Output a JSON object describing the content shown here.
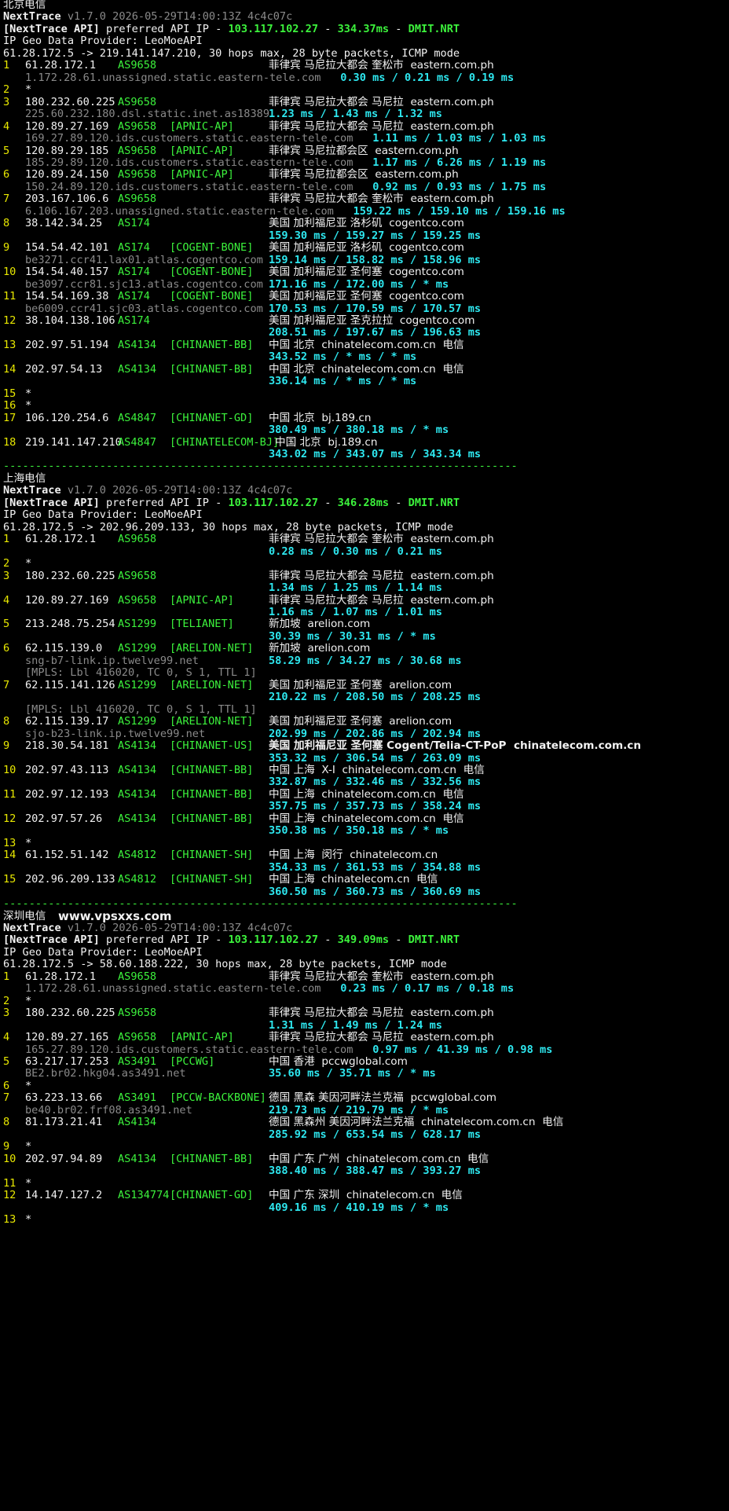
{
  "meta": {
    "tool": "NextTrace",
    "version": "v1.7.0 2026-05-29T14:00:13Z 4c4c07c",
    "api_label": "[NextTrace API]",
    "api_text": "preferred API IP - ",
    "api_ip": "103.117.102.27",
    "api_node": "DMIT.NRT",
    "geo": "IP Geo Data Provider: LeoMoeAPI",
    "separator": "--------------------------------------------------------------------------------"
  },
  "sections": [
    {
      "title": "北京电信",
      "watermark": "",
      "api_latency": "334.37ms",
      "cmd": "61.28.172.5 -> 219.141.147.210, 30 hops max, 28 byte packets, ICMP mode",
      "lines": [
        {
          "t": "hop",
          "hop": "1",
          "ip": "61.28.172.1",
          "as": "AS9658",
          "tag": "",
          "loc": "菲律宾 马尼拉大都会 奎松市",
          "domain": "eastern.com.ph",
          "isp": ""
        },
        {
          "t": "rtt",
          "ptr": "1.172.28.61.unassigned.static.eastern-tele.com",
          "rtt": "0.30 ms / 0.21 ms / 0.19 ms"
        },
        {
          "t": "star",
          "hop": "2"
        },
        {
          "t": "hop",
          "hop": "3",
          "ip": "180.232.60.225",
          "as": "AS9658",
          "tag": "",
          "loc": "菲律宾 马尼拉大都会 马尼拉",
          "domain": "eastern.com.ph",
          "isp": ""
        },
        {
          "t": "rtt",
          "ptr": "225.60.232.180.dsl.static.inet.as18389",
          "rtt": "1.23 ms / 1.43 ms / 1.32 ms"
        },
        {
          "t": "hop",
          "hop": "4",
          "ip": "120.89.27.169",
          "as": "AS9658",
          "tag": "[APNIC-AP]",
          "loc": "菲律宾 马尼拉大都会 马尼拉",
          "domain": "eastern.com.ph",
          "isp": ""
        },
        {
          "t": "rtt",
          "ptr": "169.27.89.120.ids.customers.static.eastern-tele.com",
          "rtt": "1.11 ms / 1.03 ms / 1.03 ms"
        },
        {
          "t": "hop",
          "hop": "5",
          "ip": "120.89.29.185",
          "as": "AS9658",
          "tag": "[APNIC-AP]",
          "loc": "菲律宾 马尼拉都会区",
          "domain": "eastern.com.ph",
          "isp": ""
        },
        {
          "t": "rtt",
          "ptr": "185.29.89.120.ids.customers.static.eastern-tele.com",
          "rtt": "1.17 ms / 6.26 ms / 1.19 ms"
        },
        {
          "t": "hop",
          "hop": "6",
          "ip": "120.89.24.150",
          "as": "AS9658",
          "tag": "[APNIC-AP]",
          "loc": "菲律宾 马尼拉都会区",
          "domain": "eastern.com.ph",
          "isp": ""
        },
        {
          "t": "rtt",
          "ptr": "150.24.89.120.ids.customers.static.eastern-tele.com",
          "rtt": "0.92 ms / 0.93 ms / 1.75 ms"
        },
        {
          "t": "hop",
          "hop": "7",
          "ip": "203.167.106.6",
          "as": "AS9658",
          "tag": "",
          "loc": "菲律宾 马尼拉大都会 奎松市",
          "domain": "eastern.com.ph",
          "isp": ""
        },
        {
          "t": "rtt",
          "ptr": "6.106.167.203.unassigned.static.eastern-tele.com",
          "rtt": "159.22 ms / 159.10 ms / 159.16 ms"
        },
        {
          "t": "hop",
          "hop": "8",
          "ip": "38.142.34.25",
          "as": "AS174",
          "tag": "",
          "loc": "美国 加利福尼亚 洛杉矶",
          "domain": "cogentco.com",
          "isp": ""
        },
        {
          "t": "rtt",
          "ptr": "",
          "rtt": "159.30 ms / 159.27 ms / 159.25 ms"
        },
        {
          "t": "hop",
          "hop": "9",
          "ip": "154.54.42.101",
          "as": "AS174",
          "tag": "[COGENT-BONE]",
          "loc": "美国 加利福尼亚 洛杉矶",
          "domain": "cogentco.com",
          "isp": ""
        },
        {
          "t": "rtt",
          "ptr": "be3271.ccr41.lax01.atlas.cogentco.com",
          "rtt": "159.14 ms / 158.82 ms / 158.96 ms"
        },
        {
          "t": "hop",
          "hop": "10",
          "ip": "154.54.40.157",
          "as": "AS174",
          "tag": "[COGENT-BONE]",
          "loc": "美国 加利福尼亚 圣何塞",
          "domain": "cogentco.com",
          "isp": ""
        },
        {
          "t": "rtt",
          "ptr": "be3097.ccr81.sjc13.atlas.cogentco.com",
          "rtt": "171.16 ms / 172.00 ms / * ms"
        },
        {
          "t": "hop",
          "hop": "11",
          "ip": "154.54.169.38",
          "as": "AS174",
          "tag": "[COGENT-BONE]",
          "loc": "美国 加利福尼亚 圣何塞",
          "domain": "cogentco.com",
          "isp": ""
        },
        {
          "t": "rtt",
          "ptr": "be6009.ccr41.sjc03.atlas.cogentco.com",
          "rtt": "170.53 ms / 170.59 ms / 170.57 ms"
        },
        {
          "t": "hop",
          "hop": "12",
          "ip": "38.104.138.106",
          "as": "AS174",
          "tag": "",
          "loc": "美国 加利福尼亚 圣克拉拉",
          "domain": "cogentco.com",
          "isp": ""
        },
        {
          "t": "rtt",
          "ptr": "",
          "rtt": "208.51 ms / 197.67 ms / 196.63 ms"
        },
        {
          "t": "hop",
          "hop": "13",
          "ip": "202.97.51.194",
          "as": "AS4134",
          "tag": "[CHINANET-BB]",
          "loc": "中国 北京",
          "domain": "chinatelecom.com.cn",
          "isp": "电信"
        },
        {
          "t": "rtt",
          "ptr": "",
          "rtt": "343.52 ms / * ms / * ms"
        },
        {
          "t": "hop",
          "hop": "14",
          "ip": "202.97.54.13",
          "as": "AS4134",
          "tag": "[CHINANET-BB]",
          "loc": "中国 北京",
          "domain": "chinatelecom.com.cn",
          "isp": "电信"
        },
        {
          "t": "rtt",
          "ptr": "",
          "rtt": "336.14 ms / * ms / * ms"
        },
        {
          "t": "star",
          "hop": "15"
        },
        {
          "t": "star",
          "hop": "16"
        },
        {
          "t": "hop",
          "hop": "17",
          "ip": "106.120.254.6",
          "as": "AS4847",
          "tag": "[CHINANET-GD]",
          "loc": "中国 北京",
          "domain": "bj.189.cn",
          "isp": ""
        },
        {
          "t": "rtt",
          "ptr": "",
          "rtt": "380.49 ms / 380.18 ms / * ms"
        },
        {
          "t": "hop",
          "hop": "18",
          "ip": "219.141.147.210",
          "as": "AS4847",
          "tag": "[CHINATELECOM-BJ]",
          "loc": "中国 北京",
          "domain": "bj.189.cn",
          "isp": "",
          "wide": true
        },
        {
          "t": "rtt",
          "ptr": "",
          "rtt": "343.02 ms / 343.07 ms / 343.34 ms"
        }
      ]
    },
    {
      "title": "上海电信",
      "watermark": "",
      "api_latency": "346.28ms",
      "cmd": "61.28.172.5 -> 202.96.209.133, 30 hops max, 28 byte packets, ICMP mode",
      "lines": [
        {
          "t": "hop",
          "hop": "1",
          "ip": "61.28.172.1",
          "as": "AS9658",
          "tag": "",
          "loc": "菲律宾 马尼拉大都会 奎松市",
          "domain": "eastern.com.ph",
          "isp": ""
        },
        {
          "t": "rtt",
          "ptr": "",
          "rtt": "0.28 ms / 0.30 ms / 0.21 ms"
        },
        {
          "t": "star",
          "hop": "2"
        },
        {
          "t": "hop",
          "hop": "3",
          "ip": "180.232.60.225",
          "as": "AS9658",
          "tag": "",
          "loc": "菲律宾 马尼拉大都会 马尼拉",
          "domain": "eastern.com.ph",
          "isp": ""
        },
        {
          "t": "rtt",
          "ptr": "",
          "rtt": "1.34 ms / 1.25 ms / 1.14 ms"
        },
        {
          "t": "hop",
          "hop": "4",
          "ip": "120.89.27.169",
          "as": "AS9658",
          "tag": "[APNIC-AP]",
          "loc": "菲律宾 马尼拉大都会 马尼拉",
          "domain": "eastern.com.ph",
          "isp": ""
        },
        {
          "t": "rtt",
          "ptr": "",
          "rtt": "1.16 ms / 1.07 ms / 1.01 ms"
        },
        {
          "t": "hop",
          "hop": "5",
          "ip": "213.248.75.254",
          "as": "AS1299",
          "tag": "[TELIANET]",
          "loc": "新加坡",
          "domain": "arelion.com",
          "isp": ""
        },
        {
          "t": "rtt",
          "ptr": "",
          "rtt": "30.39 ms / 30.31 ms / * ms"
        },
        {
          "t": "hop",
          "hop": "6",
          "ip": "62.115.139.0",
          "as": "AS1299",
          "tag": "[ARELION-NET]",
          "loc": "新加坡",
          "domain": "arelion.com",
          "isp": ""
        },
        {
          "t": "rtt",
          "ptr": "sng-b7-link.ip.twelve99.net",
          "rtt": "58.29 ms / 34.27 ms / 30.68 ms"
        },
        {
          "t": "mpls",
          "text": "[MPLS: Lbl 416020, TC 0, S 1, TTL 1]"
        },
        {
          "t": "hop",
          "hop": "7",
          "ip": "62.115.141.126",
          "as": "AS1299",
          "tag": "[ARELION-NET]",
          "loc": "美国 加利福尼亚 圣何塞",
          "domain": "arelion.com",
          "isp": ""
        },
        {
          "t": "rtt",
          "ptr": "",
          "rtt": "210.22 ms / 208.50 ms / 208.25 ms"
        },
        {
          "t": "mpls",
          "text": "[MPLS: Lbl 416020, TC 0, S 1, TTL 1]"
        },
        {
          "t": "hop",
          "hop": "8",
          "ip": "62.115.139.17",
          "as": "AS1299",
          "tag": "[ARELION-NET]",
          "loc": "美国 加利福尼亚 圣何塞",
          "domain": "arelion.com",
          "isp": ""
        },
        {
          "t": "rtt",
          "ptr": "sjo-b23-link.ip.twelve99.net",
          "rtt": "202.99 ms / 202.86 ms / 202.94 ms"
        },
        {
          "t": "hop",
          "hop": "9",
          "ip": "218.30.54.181",
          "as": "AS4134",
          "tag": "[CHINANET-US]",
          "loc": "美国 加利福尼亚 圣何塞 Cogent/Telia-CT-PoP",
          "domain": "chinatelecom.com.cn",
          "isp": "",
          "boldloc": true
        },
        {
          "t": "rtt",
          "ptr": "",
          "rtt": "353.32 ms / 306.54 ms / 263.09 ms"
        },
        {
          "t": "hop",
          "hop": "10",
          "ip": "202.97.43.113",
          "as": "AS4134",
          "tag": "[CHINANET-BB]",
          "loc": "中国 上海  X-I",
          "domain": "chinatelecom.com.cn",
          "isp": "电信"
        },
        {
          "t": "rtt",
          "ptr": "",
          "rtt": "332.87 ms / 332.46 ms / 332.56 ms"
        },
        {
          "t": "hop",
          "hop": "11",
          "ip": "202.97.12.193",
          "as": "AS4134",
          "tag": "[CHINANET-BB]",
          "loc": "中国 上海",
          "domain": "chinatelecom.com.cn",
          "isp": "电信"
        },
        {
          "t": "rtt",
          "ptr": "",
          "rtt": "357.75 ms / 357.73 ms / 358.24 ms"
        },
        {
          "t": "hop",
          "hop": "12",
          "ip": "202.97.57.26",
          "as": "AS4134",
          "tag": "[CHINANET-BB]",
          "loc": "中国 上海",
          "domain": "chinatelecom.com.cn",
          "isp": "电信"
        },
        {
          "t": "rtt",
          "ptr": "",
          "rtt": "350.38 ms / 350.18 ms / * ms"
        },
        {
          "t": "star",
          "hop": "13"
        },
        {
          "t": "hop",
          "hop": "14",
          "ip": "61.152.51.142",
          "as": "AS4812",
          "tag": "[CHINANET-SH]",
          "loc": "中国 上海  闵行",
          "domain": "chinatelecom.cn",
          "isp": ""
        },
        {
          "t": "rtt",
          "ptr": "",
          "rtt": "354.33 ms / 361.53 ms / 354.88 ms"
        },
        {
          "t": "hop",
          "hop": "15",
          "ip": "202.96.209.133",
          "as": "AS4812",
          "tag": "[CHINANET-SH]",
          "loc": "中国 上海",
          "domain": "chinatelecom.cn",
          "isp": "电信"
        },
        {
          "t": "rtt",
          "ptr": "",
          "rtt": "360.50 ms / 360.73 ms / 360.69 ms"
        }
      ]
    },
    {
      "title": "深圳电信",
      "watermark": "www.vpsxxs.com",
      "api_latency": "349.09ms",
      "cmd": "61.28.172.5 -> 58.60.188.222, 30 hops max, 28 byte packets, ICMP mode",
      "lines": [
        {
          "t": "hop",
          "hop": "1",
          "ip": "61.28.172.1",
          "as": "AS9658",
          "tag": "",
          "loc": "菲律宾 马尼拉大都会 奎松市",
          "domain": "eastern.com.ph",
          "isp": ""
        },
        {
          "t": "rtt",
          "ptr": "1.172.28.61.unassigned.static.eastern-tele.com",
          "rtt": "0.23 ms / 0.17 ms / 0.18 ms"
        },
        {
          "t": "star",
          "hop": "2"
        },
        {
          "t": "hop",
          "hop": "3",
          "ip": "180.232.60.225",
          "as": "AS9658",
          "tag": "",
          "loc": "菲律宾 马尼拉大都会 马尼拉",
          "domain": "eastern.com.ph",
          "isp": ""
        },
        {
          "t": "rtt",
          "ptr": "",
          "rtt": "1.31 ms / 1.49 ms / 1.24 ms"
        },
        {
          "t": "hop",
          "hop": "4",
          "ip": "120.89.27.165",
          "as": "AS9658",
          "tag": "[APNIC-AP]",
          "loc": "菲律宾 马尼拉大都会 马尼拉",
          "domain": "eastern.com.ph",
          "isp": ""
        },
        {
          "t": "rtt",
          "ptr": "165.27.89.120.ids.customers.static.eastern-tele.com",
          "rtt": "0.97 ms / 41.39 ms / 0.98 ms"
        },
        {
          "t": "hop",
          "hop": "5",
          "ip": "63.217.17.253",
          "as": "AS3491",
          "tag": "[PCCWG]",
          "loc": "中国 香港",
          "domain": "pccwglobal.com",
          "isp": ""
        },
        {
          "t": "rtt",
          "ptr": "BE2.br02.hkg04.as3491.net",
          "rtt": "35.60 ms / 35.71 ms / * ms"
        },
        {
          "t": "star",
          "hop": "6"
        },
        {
          "t": "hop",
          "hop": "7",
          "ip": "63.223.13.66",
          "as": "AS3491",
          "tag": "[PCCW-BACKBONE]",
          "loc": "德国 黑森 美因河畔法兰克福",
          "domain": "pccwglobal.com",
          "isp": ""
        },
        {
          "t": "rtt",
          "ptr": "be40.br02.frf08.as3491.net",
          "rtt": "219.73 ms / 219.79 ms / * ms"
        },
        {
          "t": "hop",
          "hop": "8",
          "ip": "81.173.21.41",
          "as": "AS4134",
          "tag": "",
          "loc": "德国 黑森州 美因河畔法兰克福",
          "domain": "chinatelecom.com.cn",
          "isp": "电信"
        },
        {
          "t": "rtt",
          "ptr": "",
          "rtt": "285.92 ms / 653.54 ms / 628.17 ms"
        },
        {
          "t": "star",
          "hop": "9"
        },
        {
          "t": "hop",
          "hop": "10",
          "ip": "202.97.94.89",
          "as": "AS4134",
          "tag": "[CHINANET-BB]",
          "loc": "中国 广东 广州",
          "domain": "chinatelecom.com.cn",
          "isp": "电信"
        },
        {
          "t": "rtt",
          "ptr": "",
          "rtt": "388.40 ms / 388.47 ms / 393.27 ms"
        },
        {
          "t": "star",
          "hop": "11"
        },
        {
          "t": "hop",
          "hop": "12",
          "ip": "14.147.127.2",
          "as": "AS134774",
          "tag": "[CHINANET-GD]",
          "loc": "中国 广东 深圳",
          "domain": "chinatelecom.cn",
          "isp": "电信"
        },
        {
          "t": "rtt",
          "ptr": "",
          "rtt": "409.16 ms / 410.19 ms / * ms"
        },
        {
          "t": "star",
          "hop": "13"
        }
      ]
    }
  ]
}
